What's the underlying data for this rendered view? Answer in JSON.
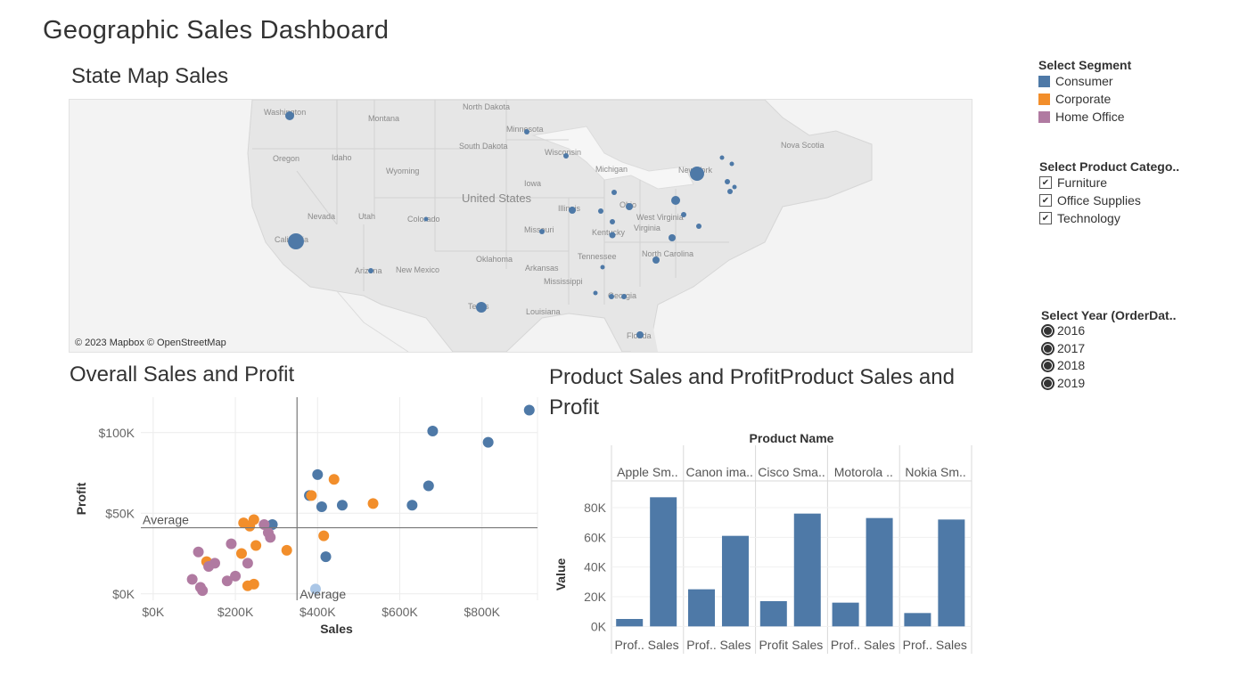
{
  "dashboard": {
    "title": "Geographic Sales Dashboard"
  },
  "map": {
    "title": "State Map Sales",
    "attribution": "© 2023 Mapbox © OpenStreetMap",
    "labels": [
      "Washington",
      "Montana",
      "North Dakota",
      "Minnesota",
      "Wisconsin",
      "Michigan",
      "Oregon",
      "Idaho",
      "South Dakota",
      "Wyoming",
      "Iowa",
      "New York",
      "Nova Scotia",
      "Nevada",
      "Utah",
      "Colorado",
      "Illinois",
      "Ohio",
      "West Virginia",
      "Virginia",
      "California",
      "Missouri",
      "Kentucky",
      "Arizona",
      "New Mexico",
      "Oklahoma",
      "Arkansas",
      "Tennessee",
      "North Carolina",
      "Mississippi",
      "Georgia",
      "Texas",
      "Louisiana",
      "Florida",
      "United States"
    ]
  },
  "filters": {
    "segment": {
      "title": "Select Segment",
      "items": [
        {
          "label": "Consumer",
          "color": "#4e79a7"
        },
        {
          "label": "Corporate",
          "color": "#f28e2b"
        },
        {
          "label": "Home Office",
          "color": "#b07aa1"
        }
      ]
    },
    "category": {
      "title": "Select Product Catego..",
      "items": [
        "Furniture",
        "Office Supplies",
        "Technology"
      ],
      "check_glyph": "✔"
    },
    "year": {
      "title": "Select Year (OrderDat..",
      "items": [
        "2016",
        "2017",
        "2018",
        "2019"
      ]
    }
  },
  "chart_data": [
    {
      "type": "scatter",
      "title": "Overall Sales and Profit",
      "xlabel": "Sales",
      "ylabel": "Profit",
      "xlim": [
        -30000,
        935000
      ],
      "ylim": [
        -4000,
        122000
      ],
      "x_ticks": [
        "$0K",
        "$200K",
        "$400K",
        "$600K",
        "$800K"
      ],
      "x_tick_values": [
        0,
        200000,
        400000,
        600000,
        800000
      ],
      "y_ticks": [
        "$0K",
        "$50K",
        "$100K"
      ],
      "y_tick_values": [
        0,
        50000,
        100000
      ],
      "reference_lines": [
        {
          "axis": "x",
          "value": 350000,
          "label": "Average"
        },
        {
          "axis": "y",
          "value": 41000,
          "label": "Average"
        }
      ],
      "series": [
        {
          "name": "Consumer",
          "color": "#4e79a7",
          "points": [
            [
              915000,
              114000
            ],
            [
              815000,
              94000
            ],
            [
              680000,
              101000
            ],
            [
              670000,
              67000
            ],
            [
              630000,
              55000
            ],
            [
              460000,
              55000
            ],
            [
              410000,
              54000
            ],
            [
              380000,
              61000
            ],
            [
              400000,
              74000
            ],
            [
              290000,
              43000
            ],
            [
              420000,
              23000
            ]
          ]
        },
        {
          "name": "Corporate",
          "color": "#f28e2b",
          "points": [
            [
              440000,
              71000
            ],
            [
              535000,
              56000
            ],
            [
              385000,
              61000
            ],
            [
              415000,
              36000
            ],
            [
              325000,
              27000
            ],
            [
              220000,
              44000
            ],
            [
              235000,
              42000
            ],
            [
              245000,
              46000
            ],
            [
              250000,
              30000
            ],
            [
              215000,
              25000
            ],
            [
              130000,
              20000
            ],
            [
              230000,
              5000
            ],
            [
              245000,
              6000
            ]
          ]
        },
        {
          "name": "Home Office",
          "color": "#b07aa1",
          "points": [
            [
              270000,
              43000
            ],
            [
              285000,
              35000
            ],
            [
              280000,
              38000
            ],
            [
              190000,
              31000
            ],
            [
              95000,
              9000
            ],
            [
              110000,
              26000
            ],
            [
              135000,
              17000
            ],
            [
              150000,
              19000
            ],
            [
              230000,
              19000
            ],
            [
              200000,
              11000
            ],
            [
              115000,
              4000
            ],
            [
              120000,
              2000
            ],
            [
              180000,
              8000
            ]
          ]
        },
        {
          "name": "",
          "color": "#aac6e6",
          "points": [
            [
              395000,
              3000
            ]
          ]
        }
      ]
    },
    {
      "type": "bar",
      "title": "Product Sales and ProfitProduct Sales and Profit",
      "column_header": "Product Name",
      "ylabel": "Value",
      "ylim": [
        -4000,
        98000
      ],
      "y_ticks": [
        "0K",
        "20K",
        "40K",
        "60K",
        "80K"
      ],
      "y_tick_values": [
        0,
        20000,
        40000,
        60000,
        80000
      ],
      "categories": [
        "Apple Sm..",
        "Canon ima..",
        "Cisco Sma..",
        "Motorola ..",
        "Nokia Sm.."
      ],
      "groups": [
        {
          "category": "Apple Sm..",
          "bars": [
            {
              "label": "Prof..",
              "value": 5000
            },
            {
              "label": "Sales",
              "value": 87000
            }
          ]
        },
        {
          "category": "Canon ima..",
          "bars": [
            {
              "label": "Prof..",
              "value": 25000
            },
            {
              "label": "Sales",
              "value": 61000
            }
          ]
        },
        {
          "category": "Cisco Sma..",
          "bars": [
            {
              "label": "Profit",
              "value": 17000
            },
            {
              "label": "Sales",
              "value": 76000
            }
          ]
        },
        {
          "category": "Motorola ..",
          "bars": [
            {
              "label": "Prof..",
              "value": 16000
            },
            {
              "label": "Sales",
              "value": 73000
            }
          ]
        },
        {
          "category": "Nokia Sm..",
          "bars": [
            {
              "label": "Prof..",
              "value": 9000
            },
            {
              "label": "Sales",
              "value": 72000
            }
          ]
        }
      ],
      "bar_color": "#4e79a7"
    }
  ]
}
